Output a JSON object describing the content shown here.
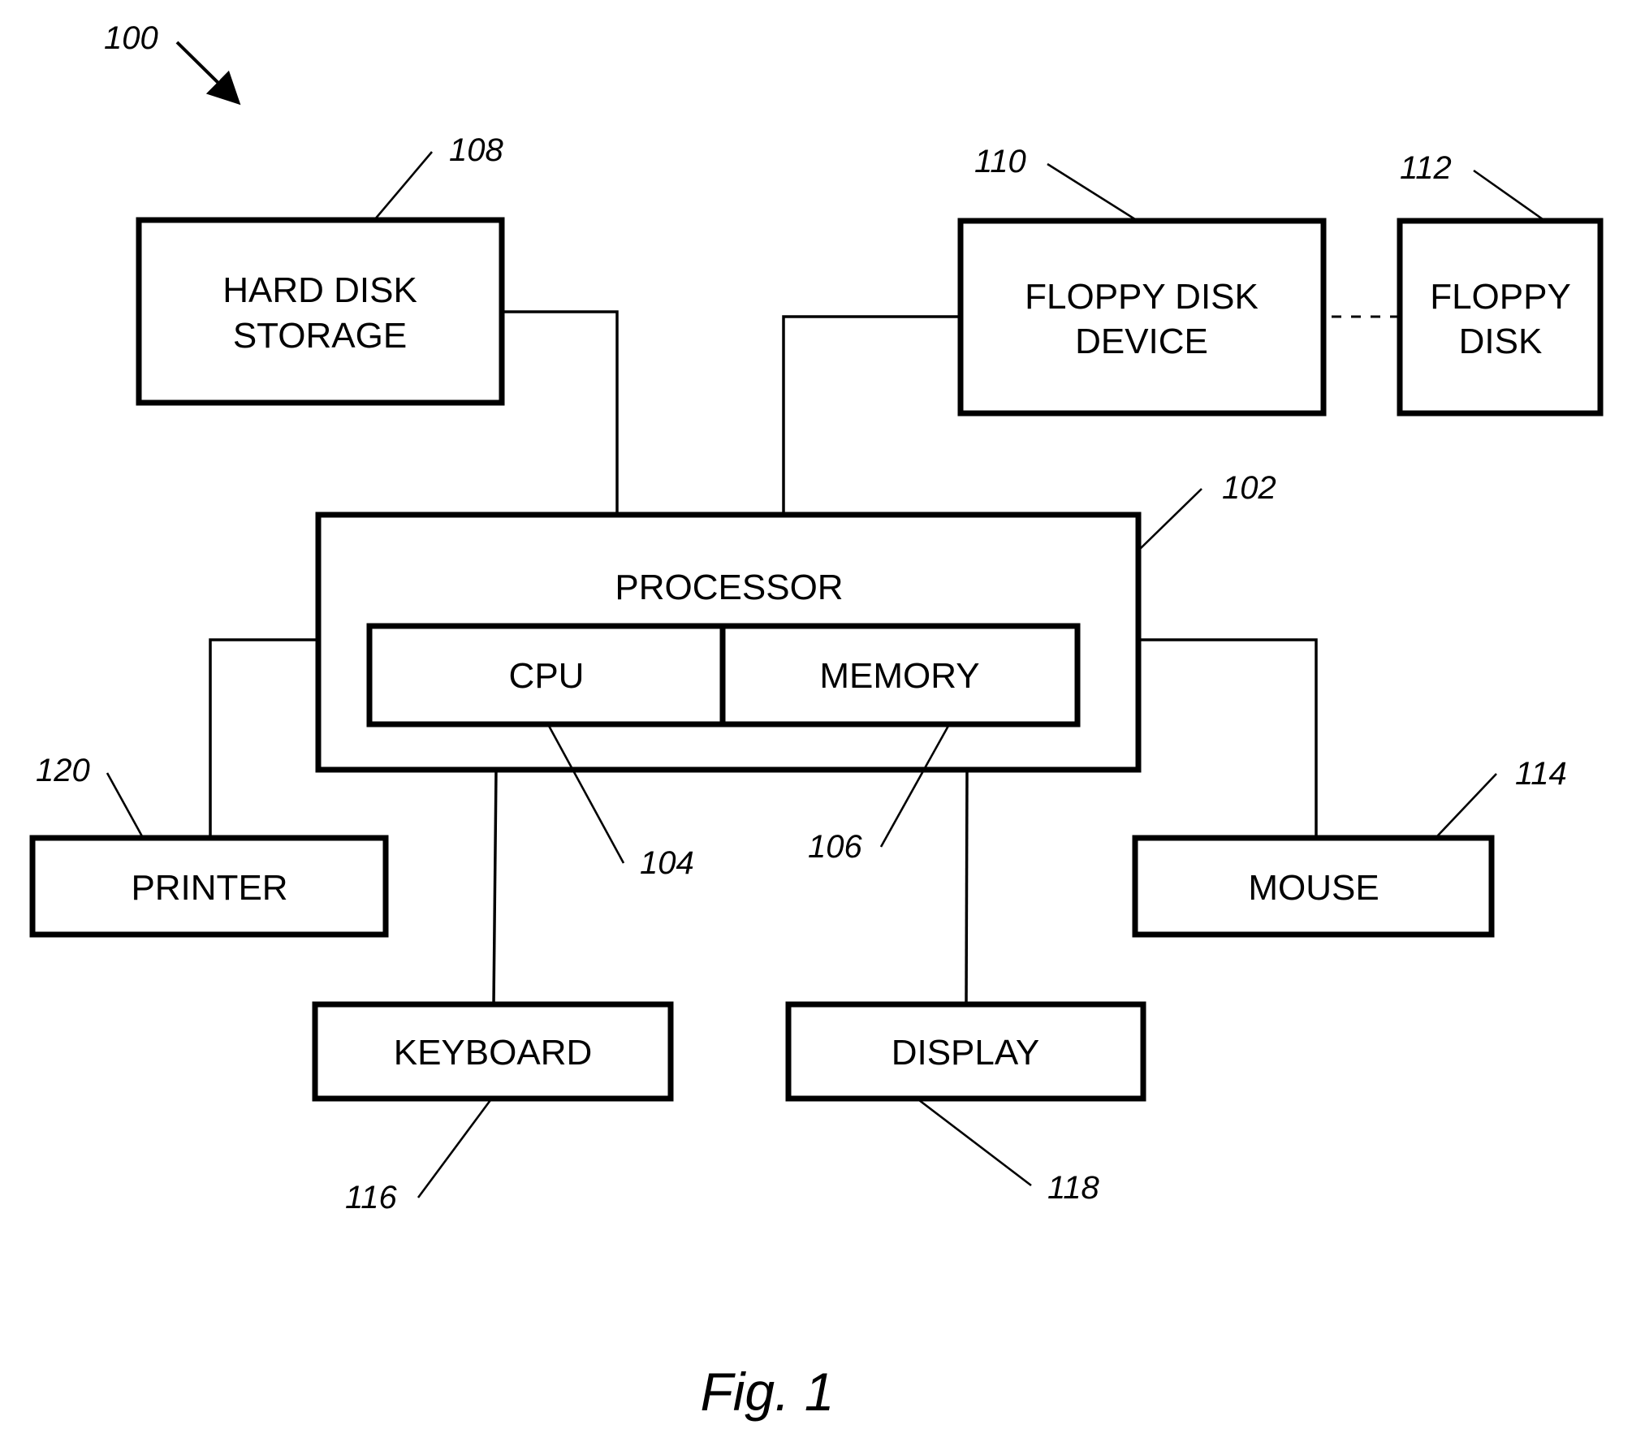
{
  "figure": {
    "caption": "Fig. 1",
    "system_ref": "100"
  },
  "blocks": {
    "hard_disk": {
      "line1": "HARD DISK",
      "line2": "STORAGE",
      "ref": "108"
    },
    "floppy_device": {
      "line1": "FLOPPY DISK",
      "line2": "DEVICE",
      "ref": "110"
    },
    "floppy_disk": {
      "line1": "FLOPPY",
      "line2": "DISK",
      "ref": "112"
    },
    "processor": {
      "label": "PROCESSOR",
      "ref": "102"
    },
    "cpu": {
      "label": "CPU",
      "ref": "104"
    },
    "memory": {
      "label": "MEMORY",
      "ref": "106"
    },
    "printer": {
      "label": "PRINTER",
      "ref": "120"
    },
    "mouse": {
      "label": "MOUSE",
      "ref": "114"
    },
    "keyboard": {
      "label": "KEYBOARD",
      "ref": "116"
    },
    "display": {
      "label": "DISPLAY",
      "ref": "118"
    }
  },
  "connections": [
    {
      "from": "hard_disk",
      "to": "processor",
      "style": "solid"
    },
    {
      "from": "floppy_device",
      "to": "processor",
      "style": "solid"
    },
    {
      "from": "floppy_disk",
      "to": "floppy_device",
      "style": "dashed"
    },
    {
      "from": "printer",
      "to": "processor",
      "style": "solid"
    },
    {
      "from": "mouse",
      "to": "processor",
      "style": "solid"
    },
    {
      "from": "keyboard",
      "to": "processor",
      "style": "solid"
    },
    {
      "from": "display",
      "to": "processor",
      "style": "solid"
    }
  ]
}
